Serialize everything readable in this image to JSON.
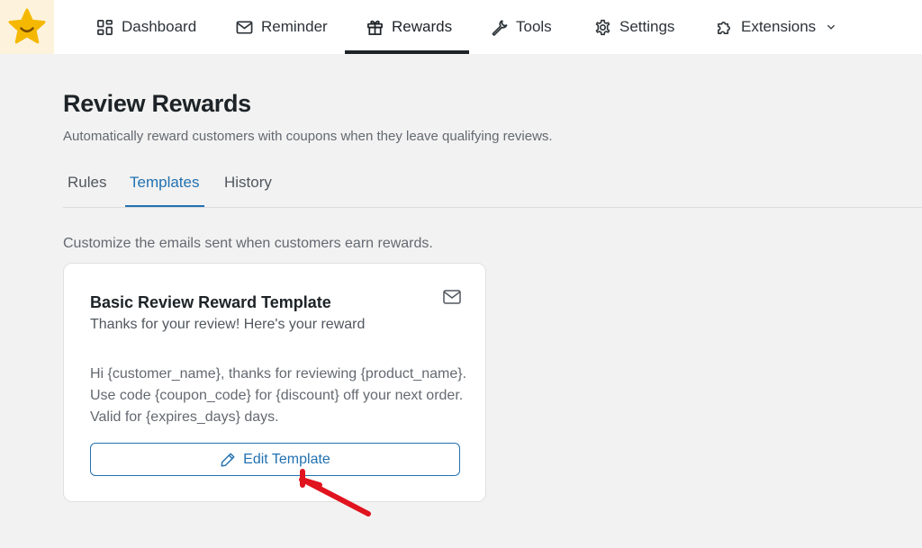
{
  "nav": {
    "items": [
      {
        "label": "Dashboard",
        "icon": "dashboard-icon"
      },
      {
        "label": "Reminder",
        "icon": "mail-icon"
      },
      {
        "label": "Rewards",
        "icon": "gift-icon",
        "active": true
      },
      {
        "label": "Tools",
        "icon": "wrench-icon"
      },
      {
        "label": "Settings",
        "icon": "gear-icon"
      },
      {
        "label": "Extensions",
        "icon": "puzzle-icon",
        "dropdown_icon": "chevron-down-icon"
      }
    ]
  },
  "page": {
    "title": "Review Rewards",
    "subtitle": "Automatically reward customers with coupons when they leave qualifying reviews."
  },
  "tabs": [
    {
      "label": "Rules"
    },
    {
      "label": "Templates",
      "active": true
    },
    {
      "label": "History"
    }
  ],
  "templates": {
    "description": "Customize the emails sent when customers earn rewards.",
    "card": {
      "title": "Basic Review Reward Template",
      "subject": "Thanks for your review! Here's your reward",
      "body": "Hi {customer_name}, thanks for reviewing {product_name}. Use code {coupon_code} for {discount} off your next order. Valid for {expires_days} days.",
      "icon": "mail-icon",
      "button_label": "Edit Template",
      "button_icon": "pencil-icon"
    }
  },
  "colors": {
    "accent": "#2271b1",
    "logo": "#f5b800",
    "arrow": "#e0141e"
  }
}
